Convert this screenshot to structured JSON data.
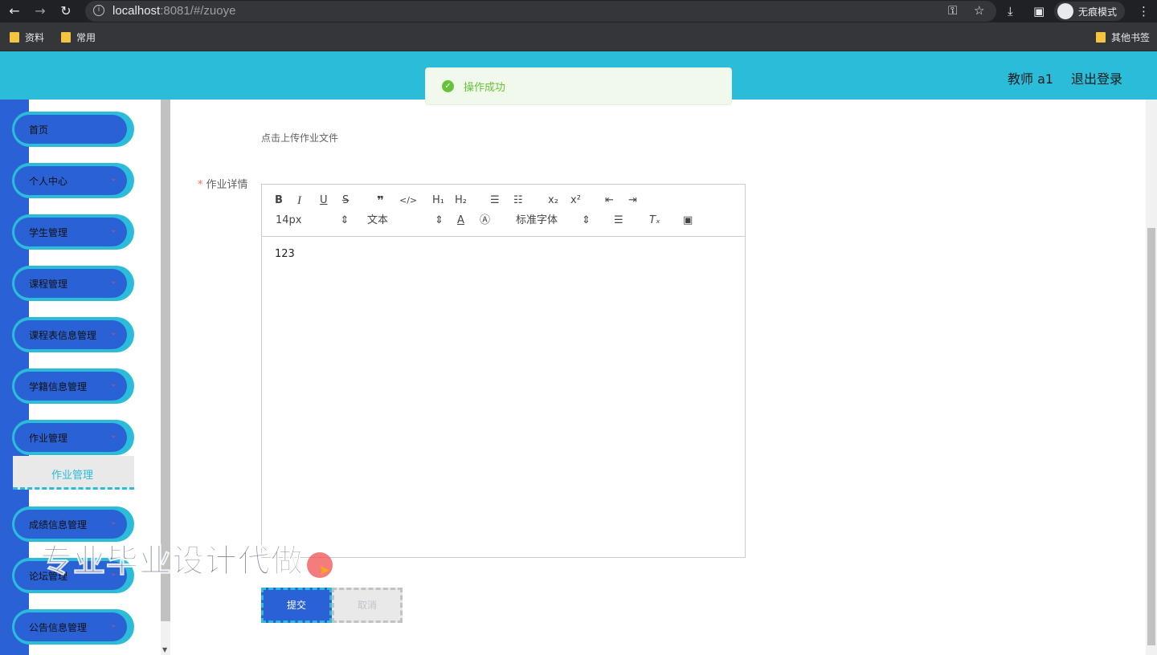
{
  "browser": {
    "url_host": "localhost",
    "url_rest": ":8081/#/zuoye",
    "incognito_label": "无痕模式",
    "bookmarks": [
      "资料",
      "常用"
    ],
    "other_bookmarks": "其他书签"
  },
  "header": {
    "user": "教师 a1",
    "logout": "退出登录"
  },
  "toast": {
    "message": "操作成功",
    "color": "#67c23a"
  },
  "sidebar": {
    "items": [
      {
        "label": "首页"
      },
      {
        "label": "个人中心",
        "arrow": "⌄"
      },
      {
        "label": "学生管理",
        "arrow": "⌄"
      },
      {
        "label": "课程管理",
        "arrow": "⌄"
      },
      {
        "label": "课程表信息管理",
        "arrow": "⌄"
      },
      {
        "label": "学籍信息管理",
        "arrow": "⌄"
      },
      {
        "label": "作业管理",
        "arrow": "⌄"
      },
      {
        "label": "成绩信息管理",
        "arrow": "⌄"
      },
      {
        "label": "论坛管理",
        "arrow": "⌄"
      },
      {
        "label": "公告信息管理",
        "arrow": "⌄"
      }
    ],
    "submenu_active": "作业管理"
  },
  "form": {
    "upload_hint": "点击上传作业文件",
    "detail_label": "作业详情",
    "required_mark": "*",
    "editor": {
      "font_size": "14px",
      "header_select": "文本",
      "font_family": "标准字体",
      "content": "123"
    },
    "submit": "提交",
    "cancel": "取消"
  },
  "watermark": "专业毕业设计代做",
  "colors": {
    "header": "#2bbcd9",
    "sidebar": "#2a62d6",
    "accent": "#2bbcd9"
  }
}
